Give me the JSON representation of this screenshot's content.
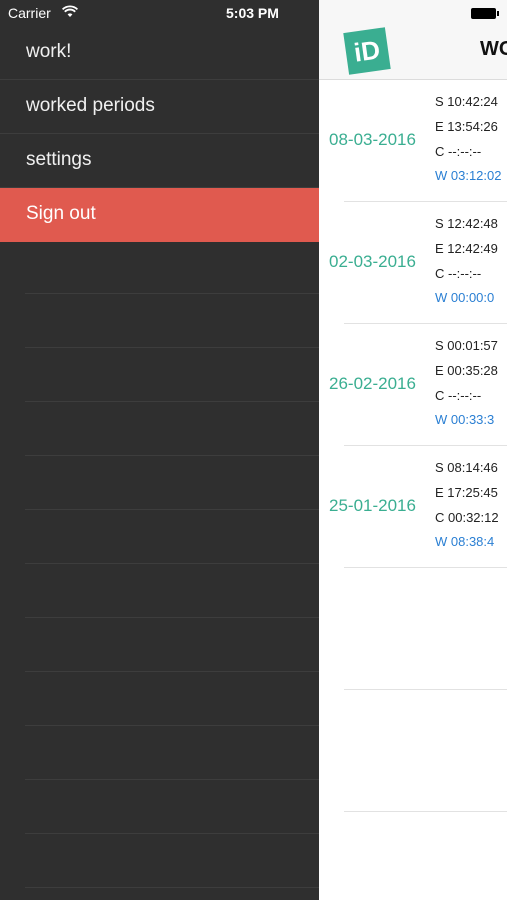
{
  "status": {
    "carrier": "Carrier",
    "time": "5:03 PM"
  },
  "menu": {
    "items": [
      {
        "label": "work!"
      },
      {
        "label": "worked periods"
      },
      {
        "label": "settings"
      },
      {
        "label": "Sign out",
        "active": true
      }
    ]
  },
  "navbar": {
    "logo_text": "iD",
    "title": "WO"
  },
  "periods": [
    {
      "date": "08-03-2016",
      "s": "S 10:42:24",
      "e": "E 13:54:26",
      "c": "C --:--:--",
      "w": "W 03:12:02"
    },
    {
      "date": "02-03-2016",
      "s": "S 12:42:48",
      "e": "E 12:42:49",
      "c": "C --:--:--",
      "w": "W 00:00:0"
    },
    {
      "date": "26-02-2016",
      "s": "S 00:01:57",
      "e": "E 00:35:28",
      "c": "C --:--:--",
      "w": "W 00:33:3"
    },
    {
      "date": "25-01-2016",
      "s": "S 08:14:46",
      "e": "E 17:25:45",
      "c": "C 00:32:12",
      "w": "W 08:38:4"
    }
  ],
  "colors": {
    "accent": "#3aae91",
    "signout": "#e05a4f",
    "work_time": "#2a7fd3",
    "drawer_bg": "#2f2f2f"
  },
  "icons": {
    "wifi": "wifi-icon",
    "battery": "battery-icon",
    "logo": "app-logo-icon"
  }
}
